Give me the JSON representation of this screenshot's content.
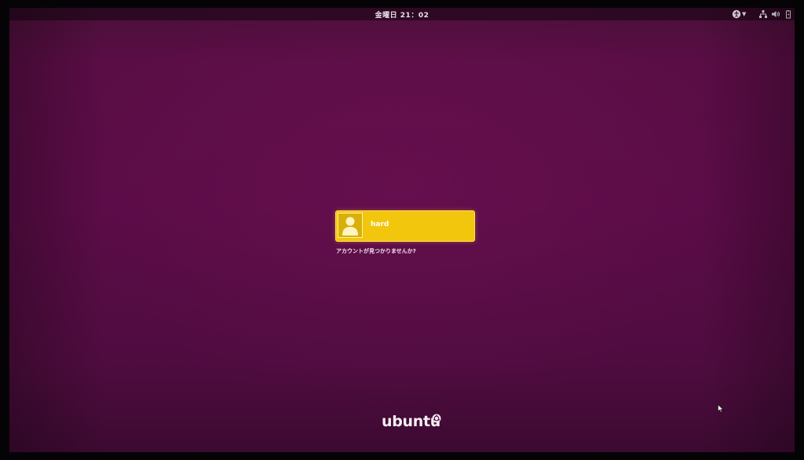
{
  "topbar": {
    "clock": "金曜日 21：02",
    "icons": [
      "accessibility-icon",
      "network-icon",
      "volume-icon",
      "battery-icon"
    ]
  },
  "login": {
    "username": "hard",
    "not_listed_link": "アカウントが見つかりませんか?"
  },
  "branding": {
    "logo_text": "ubuntu"
  },
  "colors": {
    "background": "#5b0c47",
    "user_card": "#f2c60c",
    "text": "#ffffff"
  }
}
